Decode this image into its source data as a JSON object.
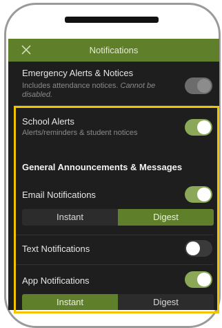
{
  "header": {
    "title": "Notifications"
  },
  "emergency": {
    "title": "Emergency Alerts & Notices",
    "subtitle": "Includes attendance notices.",
    "subtitle_note": "Cannot be disabled."
  },
  "school_alerts": {
    "title": "School Alerts",
    "subtitle": "Alerts/reminders & student notices"
  },
  "general": {
    "heading": "General Announcements & Messages"
  },
  "email": {
    "label": "Email Notifications",
    "options": [
      "Instant",
      "Digest"
    ],
    "selected": "Digest"
  },
  "text": {
    "label": "Text Notifications"
  },
  "app": {
    "label": "App Notifications",
    "options": [
      "Instant",
      "Digest"
    ],
    "selected": "Instant"
  },
  "colors": {
    "accent": "#5f7f2a",
    "toggle_on": "#8aa857",
    "highlight": "#f2c400",
    "background": "#1e1e1e"
  },
  "icons": {
    "close": "close-icon"
  }
}
